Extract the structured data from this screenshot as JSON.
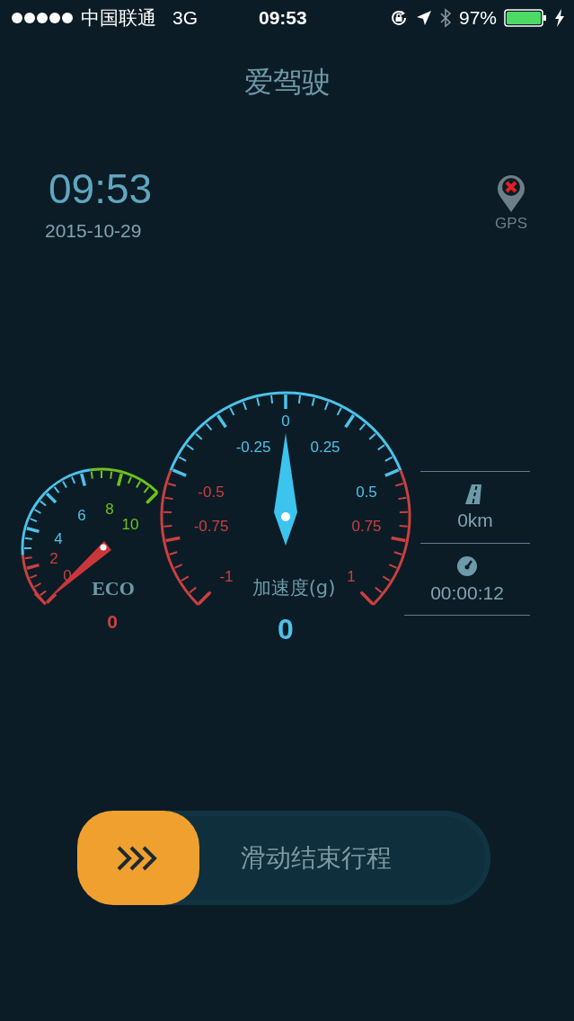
{
  "status_bar": {
    "carrier": "中国联通",
    "network": "3G",
    "time": "09:53",
    "battery": "97%",
    "charging": true
  },
  "title": "爱驾驶",
  "clock": {
    "time": "09:53",
    "date": "2015-10-29"
  },
  "gps": {
    "label": "GPS",
    "connected": false
  },
  "eco_gauge": {
    "label": "ECO",
    "value": "0",
    "ticks": [
      {
        "label": "8",
        "color": "#6cc21c"
      },
      {
        "label": "6",
        "color": "#4cc3ea"
      },
      {
        "label": "10",
        "color": "#6cc21c"
      },
      {
        "label": "4",
        "color": "#4cc3ea"
      },
      {
        "label": "2",
        "color": "#c9403f"
      },
      {
        "label": "0",
        "color": "#c9403f"
      }
    ]
  },
  "accel_gauge": {
    "label": "加速度(g)",
    "value": "0",
    "ticks": [
      {
        "label": "0",
        "color": "#4cc3ea"
      },
      {
        "label": "-0.25",
        "color": "#4cc3ea"
      },
      {
        "label": "0.25",
        "color": "#4cc3ea"
      },
      {
        "label": "-0.5",
        "color": "#c9403f"
      },
      {
        "label": "0.5",
        "color": "#4cc3ea"
      },
      {
        "label": "-0.75",
        "color": "#c9403f"
      },
      {
        "label": "0.75",
        "color": "#c9403f"
      },
      {
        "label": "-1",
        "color": "#c9403f"
      },
      {
        "label": "1",
        "color": "#c9403f"
      }
    ]
  },
  "trip": {
    "distance": "0km",
    "duration": "00:00:12"
  },
  "slider": {
    "label": "滑动结束行程",
    "level": 0
  }
}
